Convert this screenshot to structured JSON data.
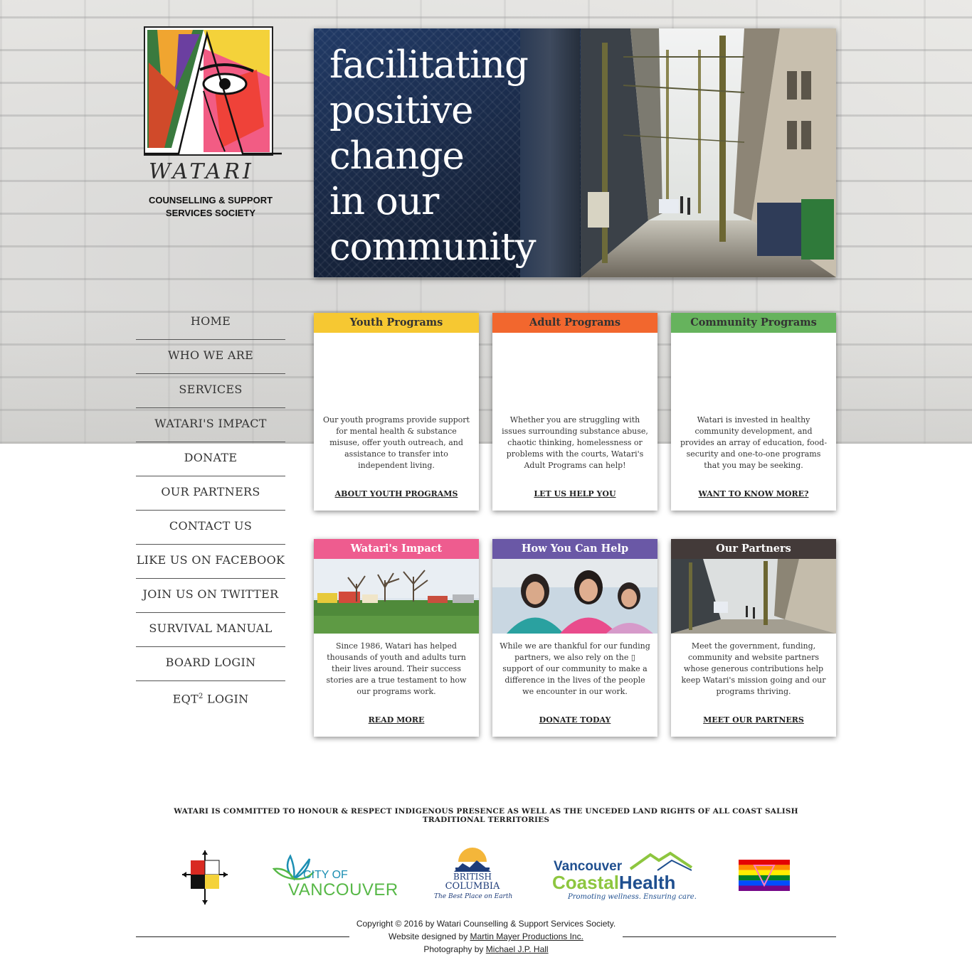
{
  "logo": {
    "wordmark": "WATARI",
    "subtitle_line1": "COUNSELLING & SUPPORT",
    "subtitle_line2": "SERVICES SOCIETY"
  },
  "hero": {
    "lines": [
      "facilitating",
      "positive",
      "change",
      "in our",
      "community"
    ]
  },
  "nav": {
    "items": [
      {
        "label": "HOME"
      },
      {
        "label": "WHO WE ARE"
      },
      {
        "label": "SERVICES"
      },
      {
        "label": "WATARI'S IMPACT"
      },
      {
        "label": "DONATE"
      },
      {
        "label": "OUR PARTNERS"
      },
      {
        "label": "CONTACT US"
      },
      {
        "label": "LIKE US ON FACEBOOK"
      },
      {
        "label": "JOIN US ON TWITTER"
      },
      {
        "label": "SURVIVAL MANUAL"
      },
      {
        "label": "BOARD LOGIN"
      },
      {
        "label_prefix": "EQT",
        "label_sup": "2",
        "label_suffix": " LOGIN"
      }
    ]
  },
  "cards": [
    {
      "title": "Youth Programs",
      "color": "#f6c832",
      "title_color": "#333333",
      "body": "Our youth programs provide support for mental health & substance misuse, offer youth outreach, and assistance to transfer into independent living.",
      "link": "ABOUT YOUTH PROGRAMS"
    },
    {
      "title": "Adult Programs",
      "color": "#f2672e",
      "title_color": "#333333",
      "body": "Whether you are struggling with issues surrounding substance abuse, chaotic thinking, homelessness or problems with the courts, Watari's Adult Programs can help!",
      "link": "LET US HELP YOU"
    },
    {
      "title": "Community Programs",
      "color": "#66b35d",
      "title_color": "#333333",
      "body": "Watari is invested in healthy community development, and provides an array of education, food-security and one-to-one programs that you may be seeking.",
      "link": "WANT TO KNOW MORE?"
    },
    {
      "title": "Watari's Impact",
      "color": "#ee5c8f",
      "title_color": "#ffffff",
      "body": "Since 1986, Watari has helped thousands of youth and adults turn their lives around. Their success stories are a true testament to how our programs work.",
      "link": "READ MORE"
    },
    {
      "title": "How You Can Help",
      "color": "#6a58a6",
      "title_color": "#ffffff",
      "body": "While we are thankful for our funding partners, we also rely on the ▯ support of our community to make a difference in the lives of the people we encounter in our work.",
      "link": "DONATE TODAY"
    },
    {
      "title": "Our Partners",
      "color": "#433a39",
      "title_color": "#ffffff",
      "body": "Meet the government, funding, community and website partners whose generous contributions help keep Watari's mission going and our programs thriving.",
      "link": "MEET OUR PARTNERS"
    }
  ],
  "footer": {
    "acknowledgement": "WATARI IS COMMITTED TO HONOUR & RESPECT INDIGENOUS PRESENCE AS WELL AS THE UNCEDED LAND RIGHTS OF ALL COAST SALISH TRADITIONAL TERRITORIES",
    "partners": {
      "vancouver_line1": "CITY OF",
      "vancouver_line2": "VANCOUVER",
      "bc_line1": "BRITISH",
      "bc_line2": "COLUMBIA",
      "bc_tagline": "The Best Place on Earth",
      "vch_line1": "Vancouver",
      "vch_line2a": "Coastal",
      "vch_line2b": "Health",
      "vch_tagline": "Promoting wellness. Ensuring care."
    },
    "copyright": "Copyright © 2016 by Watari Counselling & Support Services Society.",
    "designed_prefix": "Website designed by ",
    "designed_link": "Martin Mayer Productions Inc.",
    "photo_prefix": "Photography by ",
    "photo_link": "Michael J.P. Hall"
  },
  "colors": {
    "nav_text": "#333333",
    "footer_text": "#222222"
  }
}
